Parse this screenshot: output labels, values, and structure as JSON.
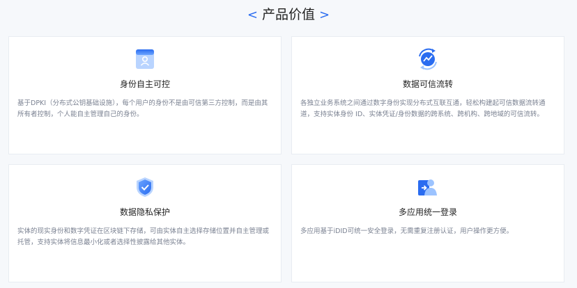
{
  "header": {
    "left_chevron": "<",
    "title": "产品价值",
    "right_chevron": ">"
  },
  "colors": {
    "accent": "#2a6cf0",
    "icon_light": "#9cc3ff",
    "background": "#f6f8fb"
  },
  "cards": [
    {
      "icon": "user-card-icon",
      "title": "身份自主可控",
      "desc": "基于DPKI（分布式公钥基础设施），每个用户的身份不是由可信第三方控制，而是由其所有者控制，个人能自主管理自己的身份。"
    },
    {
      "icon": "data-sync-icon",
      "title": "数据可信流转",
      "desc": "各独立业务系统之间通过数字身份实现分布式互联互通，轻松构建起可信数据流转通道，支持实体身份 ID、实体凭证/身份数据的跨系统、跨机构、跨地域的可信流转。"
    },
    {
      "icon": "shield-check-icon",
      "title": "数据隐私保护",
      "desc": "实体的现实身份和数字凭证在区块链下存储，可由实体自主选择存储位置并自主管理或托管，支持实体将信息最小化或者选择性披露给其他实体。"
    },
    {
      "icon": "user-login-icon",
      "title": "多应用统一登录",
      "desc": "多应用基于iDID可统一安全登录，无需重复注册认证，用户操作更方便。"
    }
  ]
}
